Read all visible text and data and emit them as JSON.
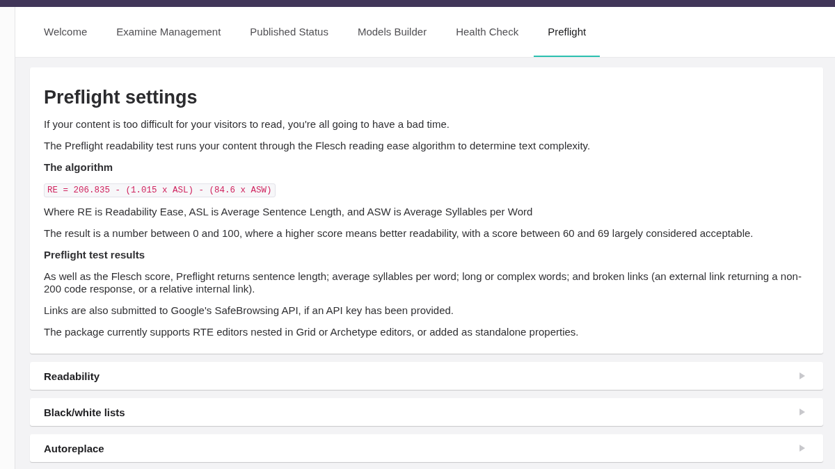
{
  "tabs": [
    {
      "label": "Welcome",
      "selected": false
    },
    {
      "label": "Examine Management",
      "selected": false
    },
    {
      "label": "Published Status",
      "selected": false
    },
    {
      "label": "Models Builder",
      "selected": false
    },
    {
      "label": "Health Check",
      "selected": false
    },
    {
      "label": "Preflight",
      "selected": true
    }
  ],
  "settings": {
    "title": "Preflight settings",
    "blocks": [
      {
        "kind": "paragraph",
        "text": "If your content is too difficult for your visitors to read, you're all going to have a bad time."
      },
      {
        "kind": "paragraph",
        "text": "The Preflight readability test runs your content through the Flesch reading ease algorithm to determine text complexity."
      },
      {
        "kind": "heading",
        "text": "The algorithm"
      },
      {
        "kind": "code",
        "text": "RE = 206.835 - (1.015 x ASL) - (84.6 x ASW)"
      },
      {
        "kind": "paragraph",
        "text": "Where RE is Readability Ease, ASL is Average Sentence Length, and ASW is Average Syllables per Word"
      },
      {
        "kind": "paragraph",
        "text": "The result is a number between 0 and 100, where a higher score means better readability, with a score between 60 and 69 largely considered acceptable."
      },
      {
        "kind": "heading",
        "text": "Preflight test results"
      },
      {
        "kind": "paragraph",
        "text": "As well as the Flesch score, Preflight returns sentence length; average syllables per word; long or complex words; and broken links (an external link returning a non-200 code response, or a relative internal link)."
      },
      {
        "kind": "paragraph",
        "text": "Links are also submitted to Google's SafeBrowsing API, if an API key has been provided."
      },
      {
        "kind": "paragraph",
        "text": "The package currently supports RTE editors nested in Grid or Archetype editors, or added as standalone properties."
      }
    ]
  },
  "panels": [
    {
      "title": "Readability",
      "expanded": false
    },
    {
      "title": "Black/white lists",
      "expanded": false
    },
    {
      "title": "Autoreplace",
      "expanded": false
    }
  ]
}
